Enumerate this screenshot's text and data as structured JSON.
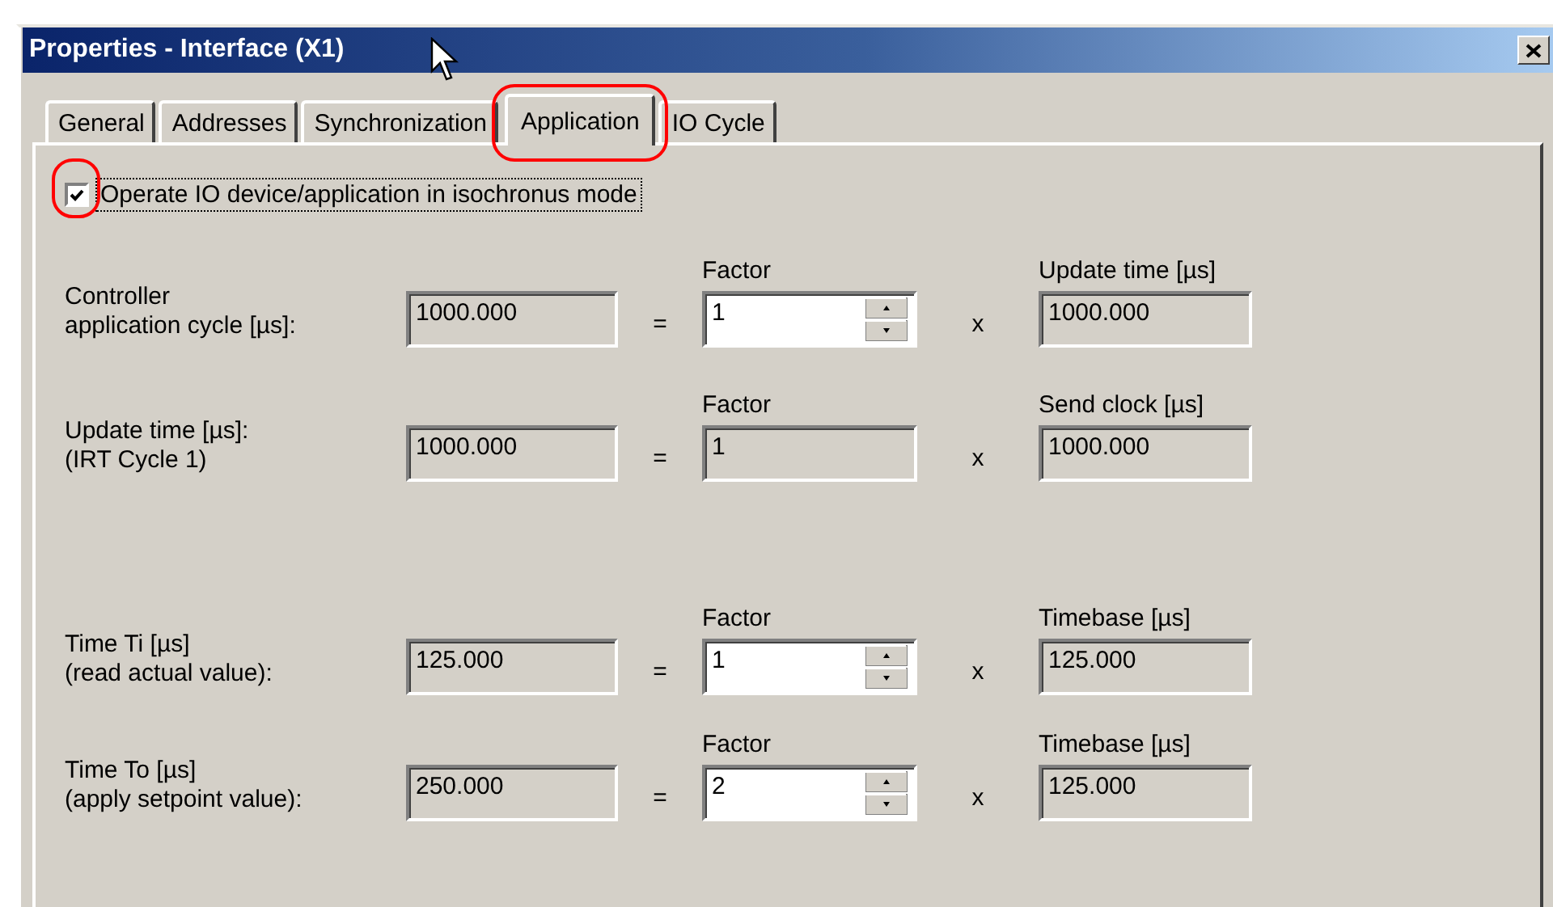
{
  "window": {
    "title": "Properties - Interface (X1)"
  },
  "tabs": [
    {
      "label": "General",
      "selected": false,
      "highlighted": false
    },
    {
      "label": "Addresses",
      "selected": false,
      "highlighted": false
    },
    {
      "label": "Synchronization",
      "selected": false,
      "highlighted": false
    },
    {
      "label": "Application",
      "selected": true,
      "highlighted": true
    },
    {
      "label": "IO Cycle",
      "selected": false,
      "highlighted": false
    }
  ],
  "checkbox": {
    "label": "Operate IO device/application in isochronus mode",
    "checked": true,
    "highlighted": true
  },
  "groups": [
    [
      {
        "label": "Controller\napplication cycle [µs]:",
        "value": "1000.000",
        "equals": "=",
        "factor_label": "Factor",
        "factor": "1",
        "factor_editable": true,
        "times": "x",
        "result_label": "Update time [µs]",
        "result": "1000.000"
      },
      {
        "label": "Update time [µs]:\n (IRT Cycle 1)",
        "value": "1000.000",
        "equals": "=",
        "factor_label": "Factor",
        "factor": "1",
        "factor_editable": false,
        "times": "x",
        "result_label": "Send clock [µs]",
        "result": "1000.000"
      }
    ],
    [
      {
        "label": "Time Ti  [µs]\n(read actual value):",
        "value": "125.000",
        "equals": "=",
        "factor_label": "Factor",
        "factor": "1",
        "factor_editable": true,
        "times": "x",
        "result_label": "Timebase [µs]",
        "result": "125.000"
      },
      {
        "label": "Time To  [µs]\n(apply setpoint value):",
        "value": "250.000",
        "equals": "=",
        "factor_label": "Factor",
        "factor": "2",
        "factor_editable": true,
        "times": "x",
        "result_label": "Timebase [µs]",
        "result": "125.000"
      }
    ]
  ]
}
